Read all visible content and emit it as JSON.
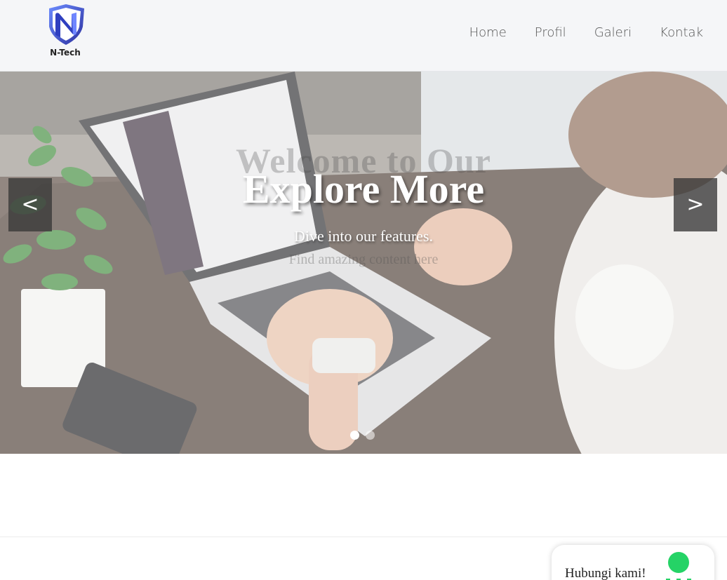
{
  "brand": {
    "name": "N-Tech",
    "logo_icon": "n-shield-logo-icon",
    "colors": {
      "shield_dark": "#2a2f9c",
      "shield_light": "#5b6cf0"
    }
  },
  "nav": {
    "items": [
      {
        "label": "Home"
      },
      {
        "label": "Profil"
      },
      {
        "label": "Galeri"
      },
      {
        "label": "Kontak"
      }
    ]
  },
  "slider": {
    "previous_slide": {
      "title": "Welcome to Our",
      "subtitle": "Find amazing content here"
    },
    "current_slide": {
      "title": "Explore More",
      "subtitle": "Dive into our features."
    },
    "prev_label": "<",
    "next_label": ">",
    "slide_count": 2,
    "active_index": 0
  },
  "contact": {
    "label": "Hubungi kami!",
    "icon": "whatsapp-icon",
    "accent": "#25d366"
  }
}
